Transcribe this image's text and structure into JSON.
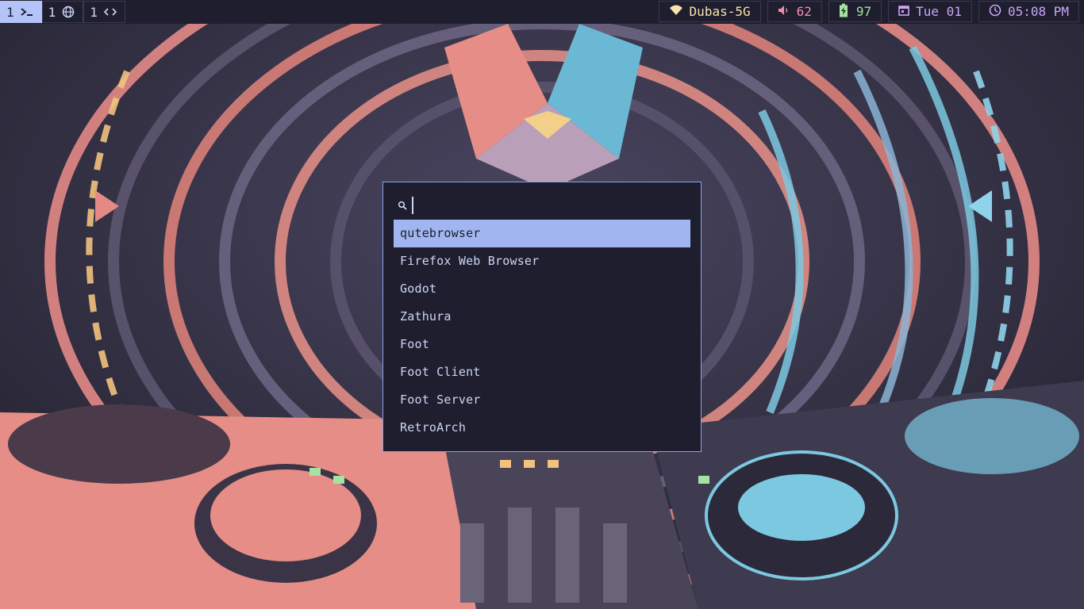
{
  "workspaces": [
    {
      "number": "1",
      "icon": "terminal-icon",
      "active": true
    },
    {
      "number": "1",
      "icon": "globe-icon",
      "active": false
    },
    {
      "number": "1",
      "icon": "code-brackets-icon",
      "active": false
    }
  ],
  "status": {
    "wifi": {
      "icon": "wifi-icon",
      "ssid": "Dubas-5G"
    },
    "volume": {
      "icon": "speaker-icon",
      "level": "62"
    },
    "battery": {
      "icon": "battery-charging-icon",
      "level": "97"
    },
    "date": {
      "icon": "calendar-icon",
      "text": "Tue 01"
    },
    "clock": {
      "icon": "clock-icon",
      "text": "05:08 PM"
    }
  },
  "launcher": {
    "search_icon": "search-icon",
    "query": "",
    "results": [
      {
        "label": "qutebrowser",
        "selected": true
      },
      {
        "label": "Firefox Web Browser",
        "selected": false
      },
      {
        "label": "Godot",
        "selected": false
      },
      {
        "label": "Zathura",
        "selected": false
      },
      {
        "label": "Foot",
        "selected": false
      },
      {
        "label": "Foot Client",
        "selected": false
      },
      {
        "label": "Foot Server",
        "selected": false
      },
      {
        "label": "RetroArch",
        "selected": false
      }
    ]
  },
  "colors": {
    "bar_bg": "#1e1e2e",
    "accent": "#a1b6f0",
    "wifi": "#f9e2af",
    "volume": "#f38ba8",
    "battery": "#a6e3a1",
    "clock": "#cba6f7"
  },
  "wallpaper": {
    "description_icon": "wallpaper-image"
  }
}
